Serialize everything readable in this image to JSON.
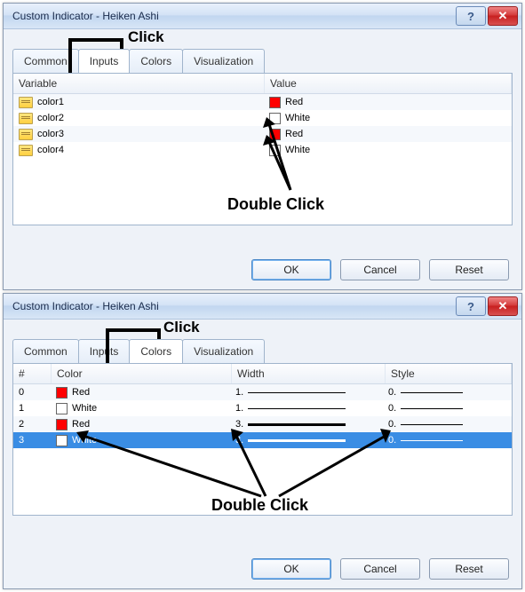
{
  "dialog1": {
    "title": "Custom Indicator - Heiken Ashi",
    "tabs": {
      "common": "Common",
      "inputs": "Inputs",
      "colors": "Colors",
      "visualization": "Visualization"
    },
    "annotation_tab": "Click",
    "columns": {
      "variable": "Variable",
      "value": "Value"
    },
    "rows": [
      {
        "var": "color1",
        "value": "Red",
        "swatch": "swatch-red"
      },
      {
        "var": "color2",
        "value": "White",
        "swatch": "swatch-white"
      },
      {
        "var": "color3",
        "value": "Red",
        "swatch": "swatch-red"
      },
      {
        "var": "color4",
        "value": "White",
        "swatch": "swatch-white"
      }
    ],
    "annotation_dbl": "Double Click",
    "buttons": {
      "ok": "OK",
      "cancel": "Cancel",
      "reset": "Reset"
    }
  },
  "dialog2": {
    "title": "Custom Indicator - Heiken Ashi",
    "tabs": {
      "common": "Common",
      "inputs": "Inputs",
      "colors": "Colors",
      "visualization": "Visualization"
    },
    "annotation_tab": "Click",
    "columns": {
      "idx": "#",
      "color": "Color",
      "width": "Width",
      "style": "Style"
    },
    "rows": [
      {
        "idx": "0",
        "color": "Red",
        "swatch": "swatch-red",
        "width": "1.",
        "wnum": 1,
        "style": "0."
      },
      {
        "idx": "1",
        "color": "White",
        "swatch": "swatch-white",
        "width": "1.",
        "wnum": 1,
        "style": "0."
      },
      {
        "idx": "2",
        "color": "Red",
        "swatch": "swatch-red",
        "width": "3.",
        "wnum": 3,
        "style": "0."
      },
      {
        "idx": "3",
        "color": "White",
        "swatch": "swatch-white",
        "width": "3.",
        "wnum": 3,
        "style": "0."
      }
    ],
    "annotation_dbl": "Double Click",
    "buttons": {
      "ok": "OK",
      "cancel": "Cancel",
      "reset": "Reset"
    }
  }
}
